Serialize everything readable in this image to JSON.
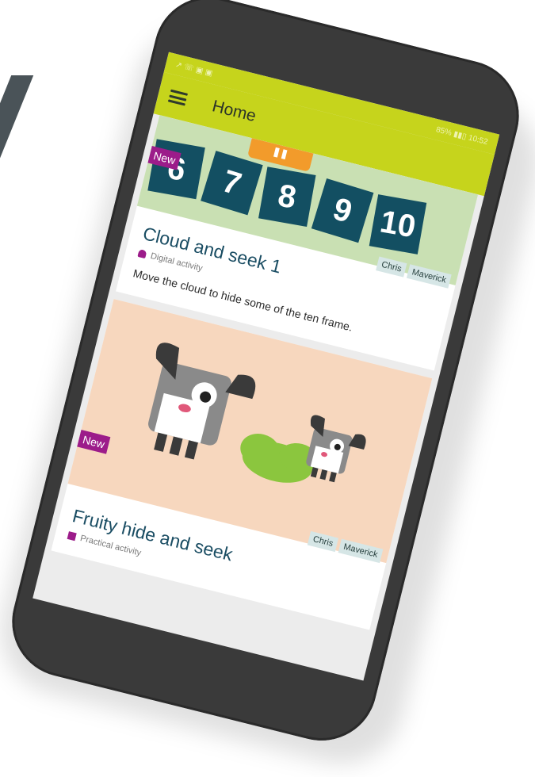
{
  "status_bar": {
    "left": "↗ ☏ ▣ ▣",
    "right": "85% ▮▮▯ 10:52"
  },
  "app_bar": {
    "title": "Home"
  },
  "cards": [
    {
      "tiles": [
        "6",
        "7",
        "8",
        "9",
        "10"
      ],
      "badge": "New",
      "tags": [
        "Chris",
        "Maverick"
      ],
      "title": "Cloud and seek 1",
      "activity": "Digital activity",
      "description": "Move the cloud to hide some of the ten frame."
    },
    {
      "badge": "New",
      "tags": [
        "Chris",
        "Maverick"
      ],
      "title": "Fruity hide and seek",
      "activity": "Practical activity"
    }
  ],
  "colors": {
    "app_bar": "#c6d41c",
    "badge": "#9c1c8a",
    "tile": "#134f62",
    "title_text": "#1a4d63"
  },
  "icons": [
    "menu-icon",
    "person-icon",
    "dice-icon",
    "dog-icon",
    "cloud-icon"
  ]
}
